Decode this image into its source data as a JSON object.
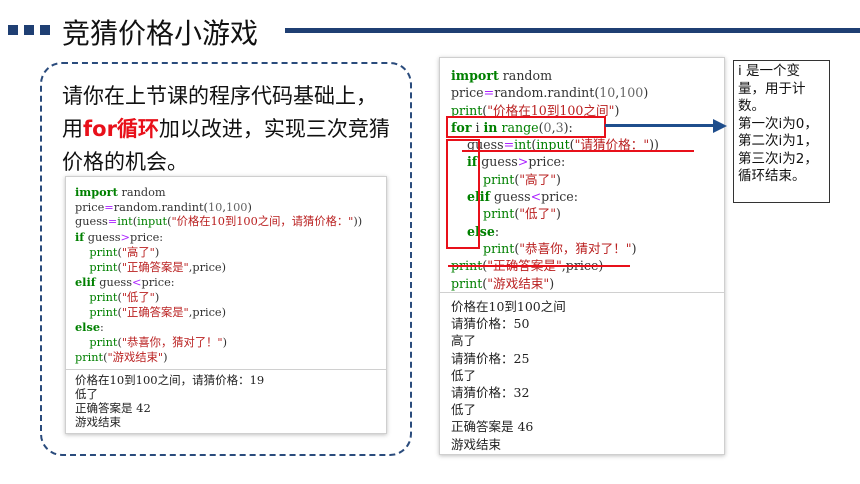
{
  "title": "竞猜价格小游戏",
  "intro": {
    "part1": "请你在上节课的程序代码基础上，用",
    "highlight": "for循环",
    "part2": "加以改进，实现三次竞猜价格的机会。"
  },
  "left_panel": {
    "code": [
      "import random",
      "price=random.randint(10,100)",
      "guess=int(input(\"价格在10到100之间，请猜价格：\"))",
      "if guess>price:",
      "    print(\"高了\")",
      "    print(\"正确答案是\",price)",
      "elif guess<price:",
      "    print(\"低了\")",
      "    print(\"正确答案是\",price)",
      "else:",
      "    print(\"恭喜你，猜对了！\")",
      "print(\"游戏结束\")"
    ],
    "output": [
      "价格在10到100之间，请猜价格：19",
      "低了",
      "正确答案是 42",
      "游戏结束"
    ]
  },
  "right_panel": {
    "code": [
      "import random",
      "price=random.randint(10,100)",
      "print(\"价格在10到100之间\")",
      "for i in range(0,3):",
      "    guess=int(input(\"请猜价格：\"))",
      "    if guess>price:",
      "        print(\"高了\")",
      "    elif guess<price:",
      "        print(\"低了\")",
      "    else:",
      "        print(\"恭喜你，猜对了！\")",
      "print(\"正确答案是\",price)",
      "print(\"游戏结束\")"
    ],
    "output": [
      "价格在10到100之间",
      "请猜价格：50",
      "高了",
      "请猜价格：25",
      "低了",
      "请猜价格：32",
      "低了",
      "正确答案是 46",
      "游戏结束"
    ]
  },
  "note": [
    "i 是一个变",
    "量，用于计",
    "数。",
    "第一次i为0，",
    "第二次i为1，",
    "第三次i为2，",
    "循环结束。"
  ],
  "colors": {
    "accent_navy": "#1f3f73",
    "highlight_red": "#e8101a",
    "keyword_green": "#008000",
    "string_red": "#ba2121"
  }
}
